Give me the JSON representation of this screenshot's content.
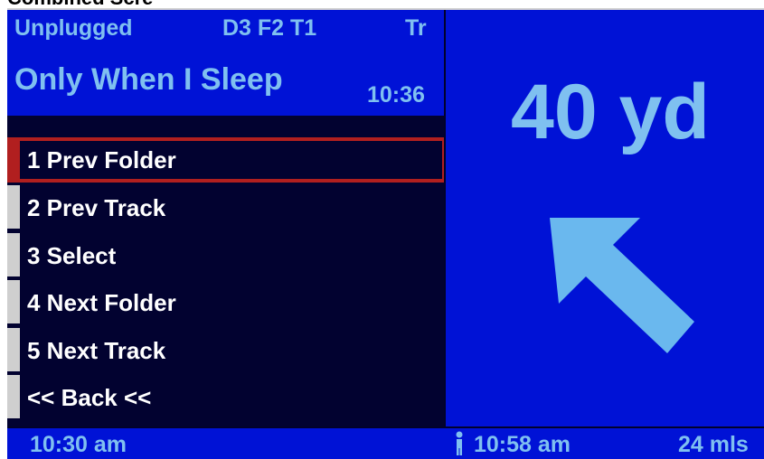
{
  "caption": "Combined Scre",
  "header": {
    "source": "Unplugged",
    "disc_track": "D3 F2 T1",
    "mode": "Tr",
    "title": "Only When I Sleep",
    "time": "10:36"
  },
  "menu": {
    "items": [
      {
        "label": "1 Prev Folder",
        "selected": true
      },
      {
        "label": "2 Prev Track",
        "selected": false
      },
      {
        "label": "3 Select",
        "selected": false
      },
      {
        "label": "4 Next Folder",
        "selected": false
      },
      {
        "label": "5 Next Track",
        "selected": false
      },
      {
        "label": "<< Back <<",
        "selected": false
      }
    ]
  },
  "navigation": {
    "distance": "40 yd",
    "direction_icon": "arrow-up-left-icon"
  },
  "footer": {
    "time": "10:30 am",
    "walk_icon": "pedestrian-icon",
    "eta": "10:58 am",
    "remaining": "24 mls"
  },
  "colors": {
    "screen_blue": "#0012d6",
    "text_light_blue": "#7fc0f0",
    "menu_bg": "#020230",
    "selection_red": "#b11f1f",
    "arrow_blue": "#6ab8ee"
  }
}
